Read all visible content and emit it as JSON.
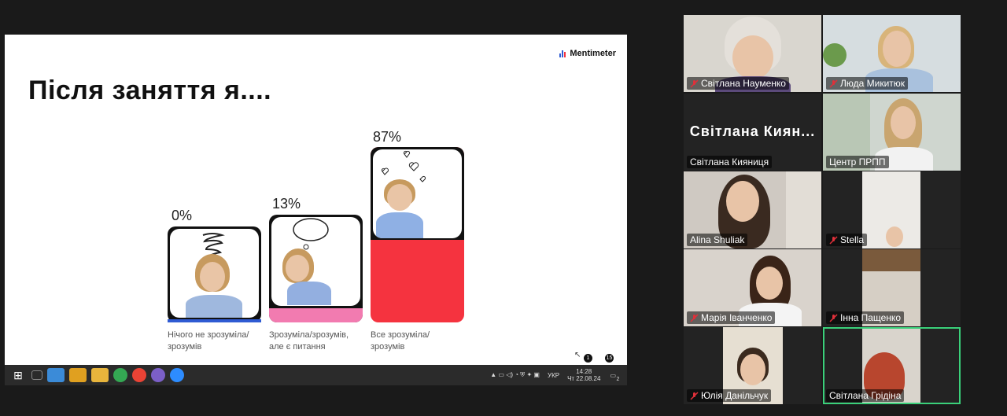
{
  "slide": {
    "title": "Після заняття я....",
    "brand": "Mentimeter",
    "bars": [
      {
        "percent": "0%",
        "label_line1": "Нічого не зрозуміла/",
        "label_line2": "зрозумів",
        "value": 0,
        "color": "#2f5bd3"
      },
      {
        "percent": "13%",
        "label_line1": "Зрозуміла/зрозумів,",
        "label_line2": "але є питання",
        "value": 13,
        "color": "#f27bb0"
      },
      {
        "percent": "87%",
        "label_line1": "Все зрозуміла/",
        "label_line2": "зрозумів",
        "value": 87,
        "color": "#f5333f"
      }
    ],
    "nav_badge_1": "1",
    "nav_badge_2": "15"
  },
  "taskbar": {
    "lang": "УКР",
    "time": "14:28",
    "date": "Чт 22.08.24",
    "notif_count": "2"
  },
  "participants": [
    {
      "name": "Світлана Науменко",
      "muted": true
    },
    {
      "name": "Люда Микитюк",
      "muted": true
    },
    {
      "name": "Світлана Кияниця",
      "muted": false,
      "display_text": "Світлана  Киян..."
    },
    {
      "name": "Центр ПРПП",
      "muted": false
    },
    {
      "name": "Alina Shuliak",
      "muted": false
    },
    {
      "name": "Stella",
      "muted": true
    },
    {
      "name": "Марія Іванченко",
      "muted": true
    },
    {
      "name": "Інна Пащенко",
      "muted": true
    },
    {
      "name": "Юлія Данільчук",
      "muted": true
    },
    {
      "name": "Світлана Грідіна",
      "muted": false,
      "active_speaker": true
    }
  ],
  "colors": {
    "active_border": "#3ad07a",
    "mute_red": "#e0303a"
  }
}
